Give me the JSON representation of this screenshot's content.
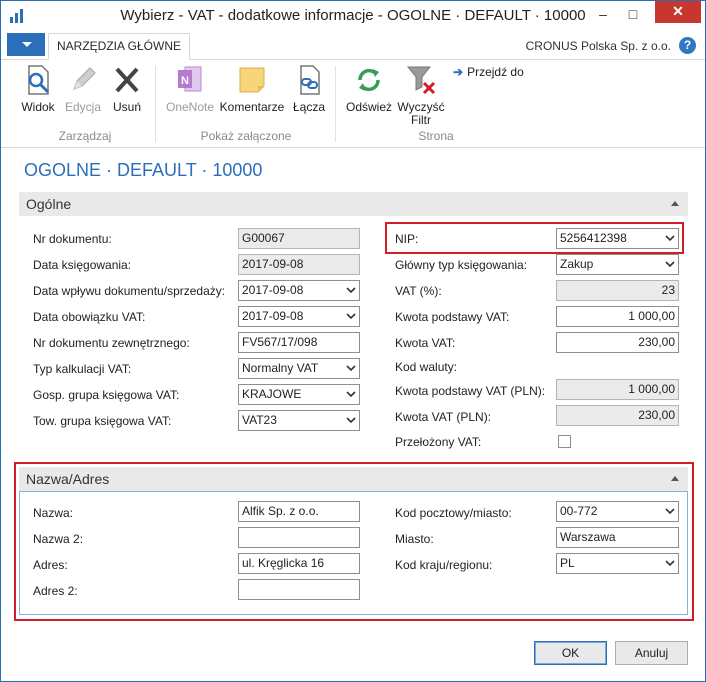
{
  "window": {
    "title": "Wybierz - VAT - dodatkowe informacje - OGOLNE · DEFAULT · 10000",
    "minimize": "–",
    "maximize": "□",
    "close": "✕"
  },
  "ribbon_tabs": {
    "home": "NARZĘDZIA GŁÓWNE"
  },
  "company": "CRONUS Polska Sp. z o.o.",
  "help": "?",
  "ribbon": {
    "view": "Widok",
    "edit": "Edycja",
    "delete": "Usuń",
    "onenote": "OneNote",
    "comments": "Komentarze",
    "links": "Łącza",
    "refresh": "Odśwież",
    "clear_filter_1": "Wyczyść",
    "clear_filter_2": "Filtr",
    "goto": "Przejdź do",
    "group_manage": "Zarządzaj",
    "group_attachments": "Pokaż załączone",
    "group_page": "Strona"
  },
  "page_title": "OGOLNE · DEFAULT · 10000",
  "general": {
    "header": "Ogólne",
    "doc_no_label": "Nr dokumentu:",
    "doc_no": "G00067",
    "posting_date_label": "Data księgowania:",
    "posting_date": "2017-09-08",
    "receipt_date_label": "Data wpływu dokumentu/sprzedaży:",
    "receipt_date": "2017-09-08",
    "vat_date_label": "Data obowiązku VAT:",
    "vat_date": "2017-09-08",
    "ext_doc_label": "Nr dokumentu zewnętrznego:",
    "ext_doc": "FV567/17/098",
    "calc_type_label": "Typ kalkulacji VAT:",
    "calc_type": "Normalny VAT",
    "bus_group_label": "Gosp. grupa księgowa VAT:",
    "bus_group": "KRAJOWE",
    "prod_group_label": "Tow. grupa księgowa VAT:",
    "prod_group": "VAT23",
    "nip_label": "NIP:",
    "nip": "5256412398",
    "gen_type_label": "Główny typ księgowania:",
    "gen_type": "Zakup",
    "vat_pct_label": "VAT (%):",
    "vat_pct": "23",
    "vat_base_label": "Kwota podstawy VAT:",
    "vat_base": "1 000,00",
    "vat_amount_label": "Kwota VAT:",
    "vat_amount": "230,00",
    "currency_label": "Kod waluty:",
    "vat_base_pln_label": "Kwota podstawy VAT (PLN):",
    "vat_base_pln": "1 000,00",
    "vat_amount_pln_label": "Kwota VAT (PLN):",
    "vat_amount_pln": "230,00",
    "postponed_label": "Przełożony VAT:"
  },
  "address": {
    "header": "Nazwa/Adres",
    "name_label": "Nazwa:",
    "name": "Alfik Sp. z o.o.",
    "name2_label": "Nazwa 2:",
    "name2": "",
    "addr_label": "Adres:",
    "addr": "ul. Kręglicka 16",
    "addr2_label": "Adres 2:",
    "addr2": "",
    "post_label": "Kod pocztowy/miasto:",
    "post": "00-772",
    "city_label": "Miasto:",
    "city": "Warszawa",
    "country_label": "Kod kraju/regionu:",
    "country": "PL"
  },
  "buttons": {
    "ok": "OK",
    "cancel": "Anuluj"
  },
  "colors": {
    "accent": "#2b6fba",
    "highlight": "#d21e2a",
    "readonly": "#ebebeb"
  }
}
